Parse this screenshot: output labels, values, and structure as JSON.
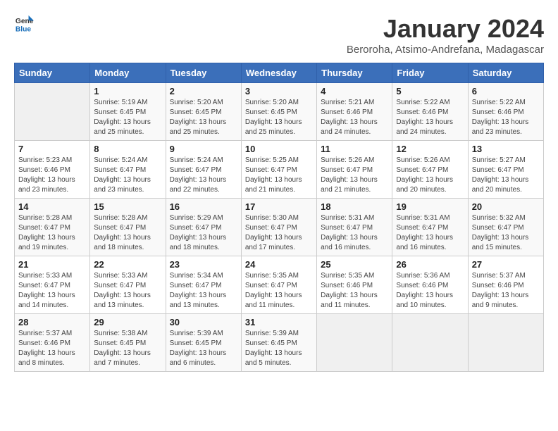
{
  "header": {
    "logo_general": "General",
    "logo_blue": "Blue",
    "month_title": "January 2024",
    "subtitle": "Beroroha, Atsimo-Andrefana, Madagascar"
  },
  "days_of_week": [
    "Sunday",
    "Monday",
    "Tuesday",
    "Wednesday",
    "Thursday",
    "Friday",
    "Saturday"
  ],
  "weeks": [
    [
      {
        "day": "",
        "info": ""
      },
      {
        "day": "1",
        "info": "Sunrise: 5:19 AM\nSunset: 6:45 PM\nDaylight: 13 hours\nand 25 minutes."
      },
      {
        "day": "2",
        "info": "Sunrise: 5:20 AM\nSunset: 6:45 PM\nDaylight: 13 hours\nand 25 minutes."
      },
      {
        "day": "3",
        "info": "Sunrise: 5:20 AM\nSunset: 6:45 PM\nDaylight: 13 hours\nand 25 minutes."
      },
      {
        "day": "4",
        "info": "Sunrise: 5:21 AM\nSunset: 6:46 PM\nDaylight: 13 hours\nand 24 minutes."
      },
      {
        "day": "5",
        "info": "Sunrise: 5:22 AM\nSunset: 6:46 PM\nDaylight: 13 hours\nand 24 minutes."
      },
      {
        "day": "6",
        "info": "Sunrise: 5:22 AM\nSunset: 6:46 PM\nDaylight: 13 hours\nand 23 minutes."
      }
    ],
    [
      {
        "day": "7",
        "info": "Sunrise: 5:23 AM\nSunset: 6:46 PM\nDaylight: 13 hours\nand 23 minutes."
      },
      {
        "day": "8",
        "info": "Sunrise: 5:24 AM\nSunset: 6:47 PM\nDaylight: 13 hours\nand 23 minutes."
      },
      {
        "day": "9",
        "info": "Sunrise: 5:24 AM\nSunset: 6:47 PM\nDaylight: 13 hours\nand 22 minutes."
      },
      {
        "day": "10",
        "info": "Sunrise: 5:25 AM\nSunset: 6:47 PM\nDaylight: 13 hours\nand 21 minutes."
      },
      {
        "day": "11",
        "info": "Sunrise: 5:26 AM\nSunset: 6:47 PM\nDaylight: 13 hours\nand 21 minutes."
      },
      {
        "day": "12",
        "info": "Sunrise: 5:26 AM\nSunset: 6:47 PM\nDaylight: 13 hours\nand 20 minutes."
      },
      {
        "day": "13",
        "info": "Sunrise: 5:27 AM\nSunset: 6:47 PM\nDaylight: 13 hours\nand 20 minutes."
      }
    ],
    [
      {
        "day": "14",
        "info": "Sunrise: 5:28 AM\nSunset: 6:47 PM\nDaylight: 13 hours\nand 19 minutes."
      },
      {
        "day": "15",
        "info": "Sunrise: 5:28 AM\nSunset: 6:47 PM\nDaylight: 13 hours\nand 18 minutes."
      },
      {
        "day": "16",
        "info": "Sunrise: 5:29 AM\nSunset: 6:47 PM\nDaylight: 13 hours\nand 18 minutes."
      },
      {
        "day": "17",
        "info": "Sunrise: 5:30 AM\nSunset: 6:47 PM\nDaylight: 13 hours\nand 17 minutes."
      },
      {
        "day": "18",
        "info": "Sunrise: 5:31 AM\nSunset: 6:47 PM\nDaylight: 13 hours\nand 16 minutes."
      },
      {
        "day": "19",
        "info": "Sunrise: 5:31 AM\nSunset: 6:47 PM\nDaylight: 13 hours\nand 16 minutes."
      },
      {
        "day": "20",
        "info": "Sunrise: 5:32 AM\nSunset: 6:47 PM\nDaylight: 13 hours\nand 15 minutes."
      }
    ],
    [
      {
        "day": "21",
        "info": "Sunrise: 5:33 AM\nSunset: 6:47 PM\nDaylight: 13 hours\nand 14 minutes."
      },
      {
        "day": "22",
        "info": "Sunrise: 5:33 AM\nSunset: 6:47 PM\nDaylight: 13 hours\nand 13 minutes."
      },
      {
        "day": "23",
        "info": "Sunrise: 5:34 AM\nSunset: 6:47 PM\nDaylight: 13 hours\nand 13 minutes."
      },
      {
        "day": "24",
        "info": "Sunrise: 5:35 AM\nSunset: 6:47 PM\nDaylight: 13 hours\nand 11 minutes."
      },
      {
        "day": "25",
        "info": "Sunrise: 5:35 AM\nSunset: 6:46 PM\nDaylight: 13 hours\nand 11 minutes."
      },
      {
        "day": "26",
        "info": "Sunrise: 5:36 AM\nSunset: 6:46 PM\nDaylight: 13 hours\nand 10 minutes."
      },
      {
        "day": "27",
        "info": "Sunrise: 5:37 AM\nSunset: 6:46 PM\nDaylight: 13 hours\nand 9 minutes."
      }
    ],
    [
      {
        "day": "28",
        "info": "Sunrise: 5:37 AM\nSunset: 6:46 PM\nDaylight: 13 hours\nand 8 minutes."
      },
      {
        "day": "29",
        "info": "Sunrise: 5:38 AM\nSunset: 6:45 PM\nDaylight: 13 hours\nand 7 minutes."
      },
      {
        "day": "30",
        "info": "Sunrise: 5:39 AM\nSunset: 6:45 PM\nDaylight: 13 hours\nand 6 minutes."
      },
      {
        "day": "31",
        "info": "Sunrise: 5:39 AM\nSunset: 6:45 PM\nDaylight: 13 hours\nand 5 minutes."
      },
      {
        "day": "",
        "info": ""
      },
      {
        "day": "",
        "info": ""
      },
      {
        "day": "",
        "info": ""
      }
    ]
  ]
}
